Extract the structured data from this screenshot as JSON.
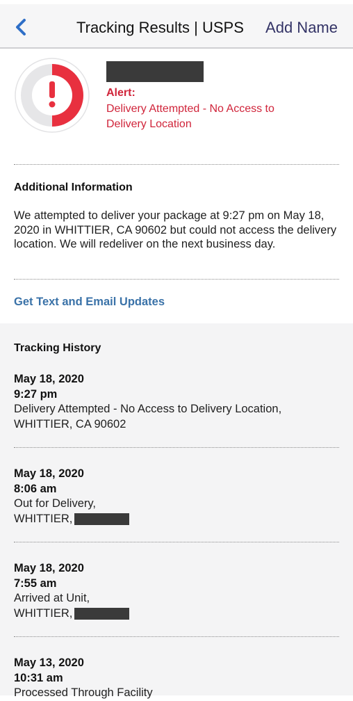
{
  "nav": {
    "title": "Tracking Results | USPS",
    "action": "Add Name"
  },
  "status": {
    "alert_label": "Alert:",
    "alert_message": "Delivery Attempted - No Access to Delivery Location",
    "ring_color": "#e8303f"
  },
  "additional": {
    "heading": "Additional Information",
    "text": "We attempted to deliver your package at 9:27 pm on May 18, 2020 in WHITTIER, CA 90602 but could not access the delivery location. We will redeliver on the next business day.",
    "updates_link": "Get Text and Email Updates"
  },
  "history": {
    "heading": "Tracking History",
    "entries": [
      {
        "date": "May 18, 2020",
        "time": "9:27 pm",
        "event": "Delivery Attempted - No Access to Delivery Location,",
        "location": "WHITTIER, CA 90602"
      },
      {
        "date": "May 18, 2020",
        "time": "8:06 am",
        "event": "Out for Delivery,",
        "location": "WHITTIER,"
      },
      {
        "date": "May 18, 2020",
        "time": "7:55 am",
        "event": "Arrived at Unit,",
        "location": "WHITTIER,"
      },
      {
        "date": "May 13, 2020",
        "time": "10:31 am",
        "event": "Processed Through Facility",
        "location": ""
      }
    ]
  }
}
